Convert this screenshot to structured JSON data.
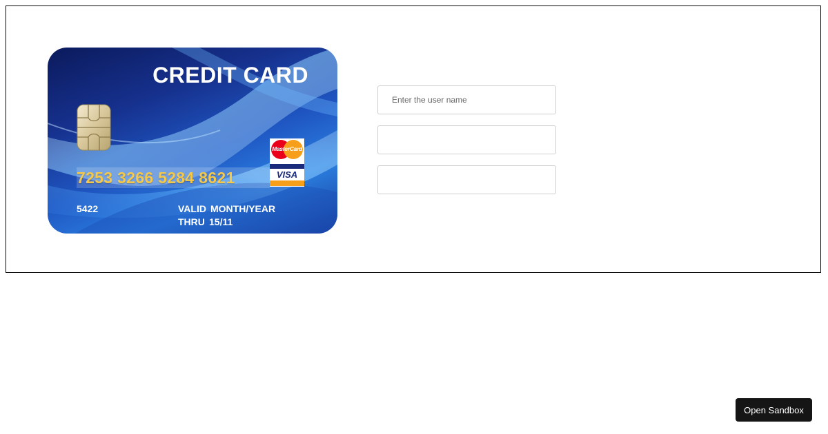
{
  "card": {
    "title": "CREDIT CARD",
    "number": "7253 3266 5284 8621",
    "code": "5422",
    "valid_label": "VALID",
    "thru_label": "THRU",
    "month_year_label": "MONTH/YEAR",
    "expiry": "15/11",
    "mastercard_text": "MasterCard",
    "visa_text": "VISA"
  },
  "form": {
    "username_placeholder": "Enter the user name",
    "field2_value": "",
    "field3_value": ""
  },
  "sandbox_button": {
    "label": "Open Sandbox"
  },
  "colors": {
    "card_dark": "#0b1a5c",
    "card_light": "#2b7fe0",
    "number_gold": "#f5c84a",
    "button_bg": "#151515",
    "mastercard_red": "#eb001b",
    "mastercard_orange": "#f79e1b",
    "visa_blue": "#1a2a7a"
  }
}
